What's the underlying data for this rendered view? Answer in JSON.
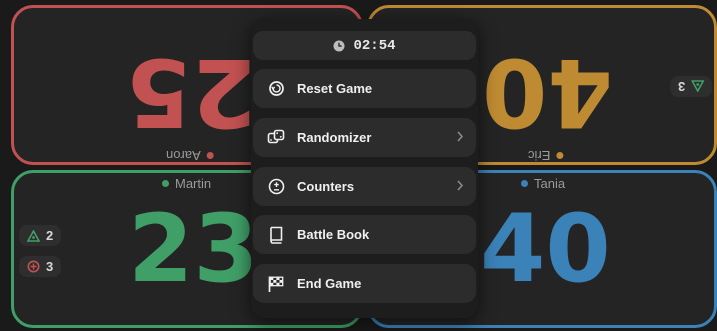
{
  "players": {
    "aaron": {
      "name": "Aaron",
      "life": "25",
      "color": "#c25152"
    },
    "eric": {
      "name": "Eric",
      "life": "40",
      "color": "#be8a32",
      "counter_value": "3"
    },
    "martin": {
      "name": "Martin",
      "life": "23",
      "color": "#3f9f67",
      "counter_poison": "2",
      "counter_other": "3"
    },
    "tania": {
      "name": "Tania",
      "life": "40",
      "color": "#3a82b8"
    }
  },
  "menu": {
    "timer": "02:54",
    "items": [
      {
        "label": "Reset Game",
        "icon": "reset-icon"
      },
      {
        "label": "Randomizer",
        "icon": "dice-icon",
        "has_submenu": true
      },
      {
        "label": "Counters",
        "icon": "plus-minus-icon",
        "has_submenu": true
      },
      {
        "label": "Battle Book",
        "icon": "book-icon"
      },
      {
        "label": "End Game",
        "icon": "checkered-flag-icon"
      }
    ]
  }
}
